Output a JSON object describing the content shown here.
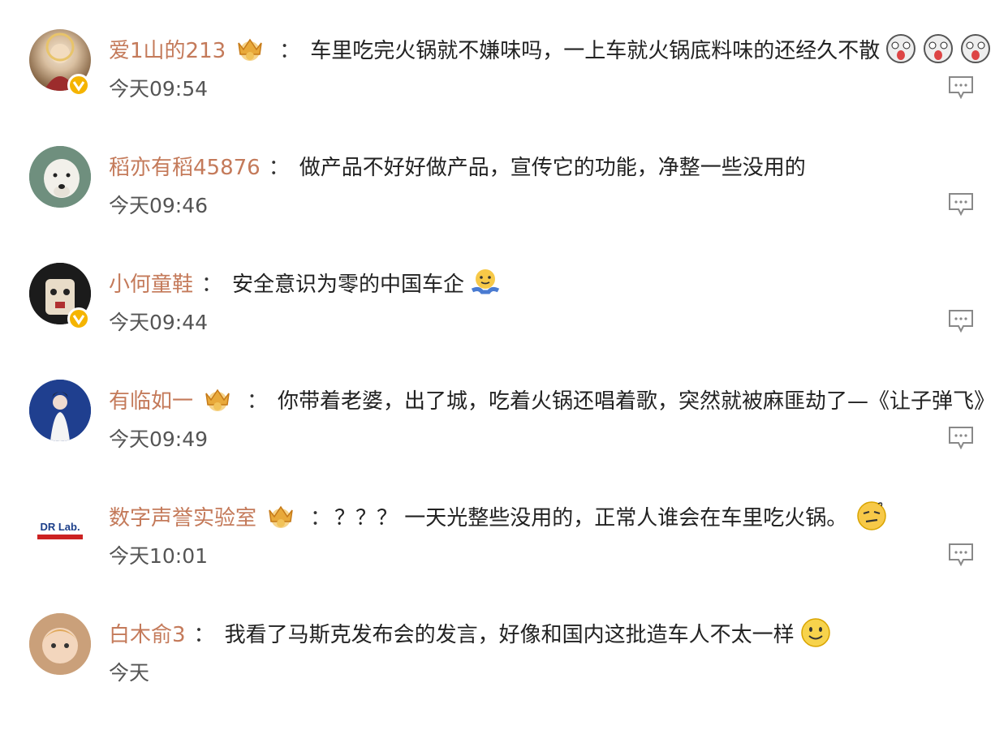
{
  "comments": [
    {
      "user": "爱1山的213",
      "text": "车里吃完火锅就不嫌味吗，一上车就火锅底料味的还经久不散",
      "time": "今天09:54"
    },
    {
      "user": "稻亦有稻45876",
      "text": "做产品不好好做产品，宣传它的功能，净整一些没用的",
      "time": "今天09:46"
    },
    {
      "user": "小何童鞋",
      "text": "安全意识为零的中国车企",
      "time": "今天09:44"
    },
    {
      "user": "有临如一",
      "text": "你带着老婆，出了城，吃着火锅还唱着歌，突然就被麻匪劫了—《让子弹飞》",
      "time": "今天09:49"
    },
    {
      "user": "数字声誉实验室",
      "text": "？？？ 一天光整些没用的，正常人谁会在车里吃火锅。",
      "time": "今天10:01",
      "avatar_text": "DR Lab."
    },
    {
      "user": "白木俞3",
      "text": "我看了马斯克发布会的发言，好像和国内这批造车人不太一样",
      "time": "今天"
    }
  ],
  "colon": "：",
  "colors": {
    "username": "#c47a5a",
    "badge": "#f5b400",
    "icon": "#888888"
  },
  "icons": {
    "reply": "comment-reply-icon",
    "badge": "verified-badge-icon",
    "crown": "member-crown-icon"
  }
}
